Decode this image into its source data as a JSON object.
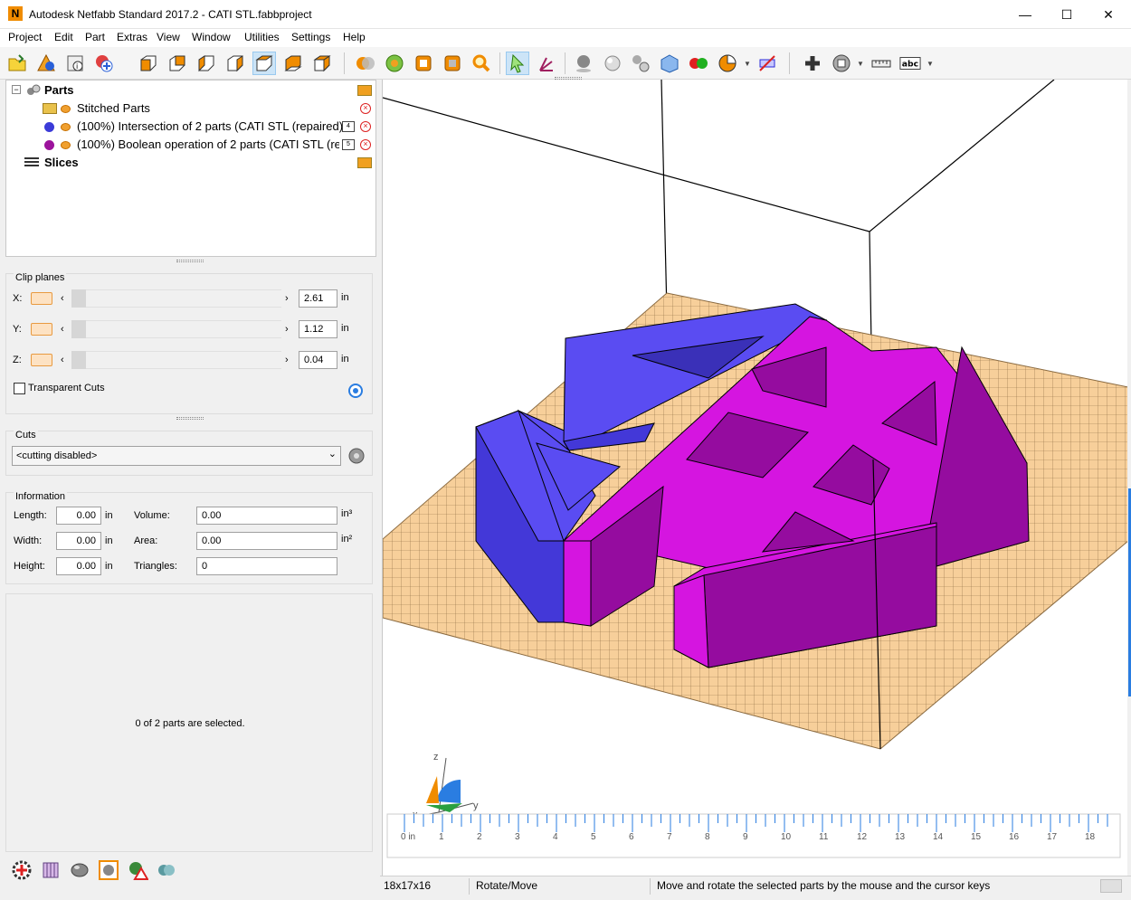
{
  "window": {
    "title": "Autodesk Netfabb Standard 2017.2 - CATI STL.fabbproject",
    "app_icon_letter": "N",
    "minimize_glyph": "—",
    "maximize_glyph": "☐",
    "close_glyph": "✕"
  },
  "menu": [
    "Project",
    "Edit",
    "Part",
    "Extras",
    "View",
    "Window",
    "Utilities",
    "Settings",
    "Help"
  ],
  "toolbar": {
    "icons": [
      "open-project-icon",
      "add-part-icon",
      "part-info-icon",
      "add-part-alt-icon",
      "view-front-icon",
      "view-back-icon",
      "view-left-icon",
      "view-right-icon",
      "view-top-icon",
      "view-bottom-icon",
      "view-perspective-icon",
      "boolean-icon",
      "repair-icon",
      "cube-frame-icon",
      "cube-fit-icon",
      "zoom-icon",
      "select-arrow-icon",
      "move-axis-icon",
      "sphere-dark-icon",
      "sphere-light-icon",
      "sphere-group-icon",
      "cube-net-icon",
      "color-spheres-icon",
      "pie-icon",
      "measure-label-icon",
      "plus-icon",
      "section-icon",
      "ruler-icon",
      "text-label-icon"
    ],
    "text_label": "abc"
  },
  "tree": {
    "parts_label": "Parts",
    "items": [
      {
        "label": "Stitched Parts"
      },
      {
        "label": "(100%) Intersection of 2 parts (CATI STL (repaired)",
        "badge": "4",
        "color": "#3b3bd8"
      },
      {
        "label": "(100%) Boolean operation of 2 parts (CATI STL (re",
        "badge": "5",
        "color": "#9c139c"
      }
    ],
    "slices_label": "Slices"
  },
  "clip": {
    "title": "Clip planes",
    "rows": [
      {
        "axis": "X:",
        "value": "2.61",
        "unit": "in"
      },
      {
        "axis": "Y:",
        "value": "1.12",
        "unit": "in"
      },
      {
        "axis": "Z:",
        "value": "0.04",
        "unit": "in"
      }
    ],
    "left_arrow": "‹",
    "right_arrow": "›",
    "transparent_label": "Transparent Cuts",
    "transparent_checked": false
  },
  "cuts": {
    "title": "Cuts",
    "selected": "<cutting disabled>",
    "arrow": "⌄"
  },
  "info": {
    "title": "Information",
    "length_label": "Length:",
    "length": "0.00",
    "length_unit": "in",
    "width_label": "Width:",
    "width": "0.00",
    "width_unit": "in",
    "height_label": "Height:",
    "height": "0.00",
    "height_unit": "in",
    "volume_label": "Volume:",
    "volume": "0.00",
    "volume_unit": "in³",
    "area_label": "Area:",
    "area": "0.00",
    "area_unit": "in²",
    "triangles_label": "Triangles:",
    "triangles": "0"
  },
  "selection_text": "0 of 2 parts are selected.",
  "viewport": {
    "axis_x": "x",
    "axis_y": "y",
    "axis_z": "z",
    "ruler_unit_label": "0 in",
    "ruler_labels": [
      "1",
      "2",
      "3",
      "4",
      "5",
      "6",
      "7",
      "8",
      "9",
      "10",
      "11",
      "12",
      "13",
      "14",
      "15",
      "16",
      "17",
      "18"
    ],
    "colors": {
      "blue_top": "#5a4cf2",
      "blue_side": "#4338d8",
      "magenta_top": "#d515e0",
      "magenta_side": "#950c9f",
      "plate": "#f7cf9a"
    }
  },
  "status": {
    "size": "18x17x16",
    "mode": "Rotate/Move",
    "hint": "Move and rotate the selected parts by the mouse and the cursor keys"
  }
}
